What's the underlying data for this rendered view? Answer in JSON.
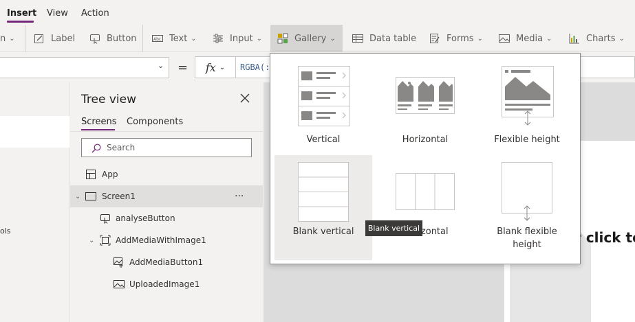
{
  "menu": {
    "tabs": [
      {
        "label": "Insert",
        "active": true
      },
      {
        "label": "View",
        "active": false
      },
      {
        "label": "Action",
        "active": false
      }
    ]
  },
  "ribbon": {
    "partial_label": "n",
    "label": "Label",
    "button": "Button",
    "text": "Text",
    "input": "Input",
    "gallery": "Gallery",
    "data_table": "Data table",
    "forms": "Forms",
    "media": "Media",
    "charts": "Charts"
  },
  "formula": {
    "equals": "=",
    "fx": "fx",
    "value": "RGBA(:"
  },
  "left_panel": {
    "text": "ols"
  },
  "tree": {
    "title": "Tree view",
    "tabs": [
      "Screens",
      "Components"
    ],
    "search_placeholder": "Search",
    "items": [
      {
        "label": "App"
      },
      {
        "label": "Screen1",
        "more": "···"
      },
      {
        "label": "analyseButton"
      },
      {
        "label": "AddMediaWithImage1"
      },
      {
        "label": "AddMediaButton1"
      },
      {
        "label": "UploadedImage1"
      }
    ]
  },
  "canvas": {
    "text": "r click to"
  },
  "gallery_menu": {
    "items": [
      {
        "label": "Vertical"
      },
      {
        "label": "Horizontal"
      },
      {
        "label": "Flexible height"
      },
      {
        "label": "Blank vertical"
      },
      {
        "label": "Blank horizontal"
      },
      {
        "label": "Blank flexible height"
      }
    ],
    "visible_labels": {
      "blank_horizontal_partial": "orizontal",
      "blank_flexible_line1": "Blank flexible",
      "blank_flexible_line2": "height"
    }
  },
  "tooltip": {
    "text": "Blank vertical"
  },
  "colors": {
    "accent": "#742774",
    "thumb_grey": "#8a8886",
    "hover_bg": "#edebe9"
  }
}
